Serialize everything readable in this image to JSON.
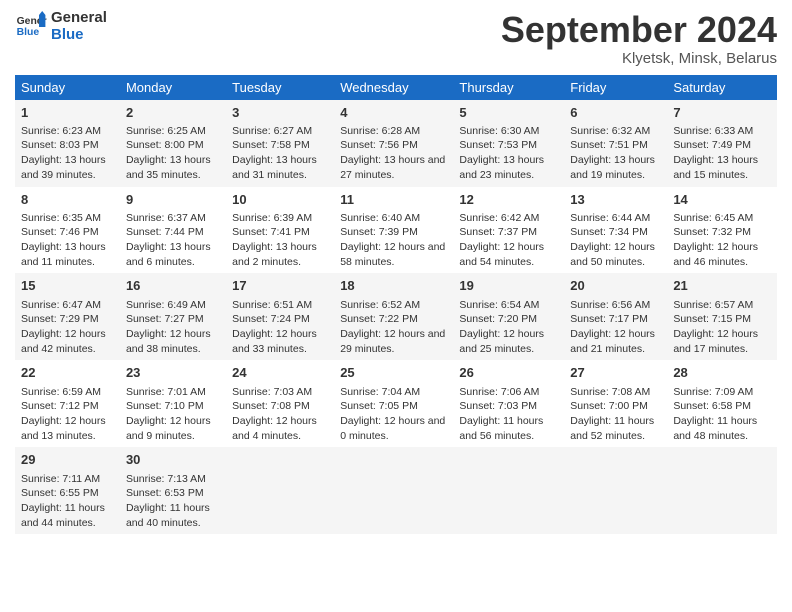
{
  "header": {
    "logo_line1": "General",
    "logo_line2": "Blue",
    "month": "September 2024",
    "location": "Klyetsk, Minsk, Belarus"
  },
  "days_of_week": [
    "Sunday",
    "Monday",
    "Tuesday",
    "Wednesday",
    "Thursday",
    "Friday",
    "Saturday"
  ],
  "weeks": [
    [
      {
        "day": "1",
        "sunrise": "6:23 AM",
        "sunset": "8:03 PM",
        "daylight": "13 hours and 39 minutes."
      },
      {
        "day": "2",
        "sunrise": "6:25 AM",
        "sunset": "8:00 PM",
        "daylight": "13 hours and 35 minutes."
      },
      {
        "day": "3",
        "sunrise": "6:27 AM",
        "sunset": "7:58 PM",
        "daylight": "13 hours and 31 minutes."
      },
      {
        "day": "4",
        "sunrise": "6:28 AM",
        "sunset": "7:56 PM",
        "daylight": "13 hours and 27 minutes."
      },
      {
        "day": "5",
        "sunrise": "6:30 AM",
        "sunset": "7:53 PM",
        "daylight": "13 hours and 23 minutes."
      },
      {
        "day": "6",
        "sunrise": "6:32 AM",
        "sunset": "7:51 PM",
        "daylight": "13 hours and 19 minutes."
      },
      {
        "day": "7",
        "sunrise": "6:33 AM",
        "sunset": "7:49 PM",
        "daylight": "13 hours and 15 minutes."
      }
    ],
    [
      {
        "day": "8",
        "sunrise": "6:35 AM",
        "sunset": "7:46 PM",
        "daylight": "13 hours and 11 minutes."
      },
      {
        "day": "9",
        "sunrise": "6:37 AM",
        "sunset": "7:44 PM",
        "daylight": "13 hours and 6 minutes."
      },
      {
        "day": "10",
        "sunrise": "6:39 AM",
        "sunset": "7:41 PM",
        "daylight": "13 hours and 2 minutes."
      },
      {
        "day": "11",
        "sunrise": "6:40 AM",
        "sunset": "7:39 PM",
        "daylight": "12 hours and 58 minutes."
      },
      {
        "day": "12",
        "sunrise": "6:42 AM",
        "sunset": "7:37 PM",
        "daylight": "12 hours and 54 minutes."
      },
      {
        "day": "13",
        "sunrise": "6:44 AM",
        "sunset": "7:34 PM",
        "daylight": "12 hours and 50 minutes."
      },
      {
        "day": "14",
        "sunrise": "6:45 AM",
        "sunset": "7:32 PM",
        "daylight": "12 hours and 46 minutes."
      }
    ],
    [
      {
        "day": "15",
        "sunrise": "6:47 AM",
        "sunset": "7:29 PM",
        "daylight": "12 hours and 42 minutes."
      },
      {
        "day": "16",
        "sunrise": "6:49 AM",
        "sunset": "7:27 PM",
        "daylight": "12 hours and 38 minutes."
      },
      {
        "day": "17",
        "sunrise": "6:51 AM",
        "sunset": "7:24 PM",
        "daylight": "12 hours and 33 minutes."
      },
      {
        "day": "18",
        "sunrise": "6:52 AM",
        "sunset": "7:22 PM",
        "daylight": "12 hours and 29 minutes."
      },
      {
        "day": "19",
        "sunrise": "6:54 AM",
        "sunset": "7:20 PM",
        "daylight": "12 hours and 25 minutes."
      },
      {
        "day": "20",
        "sunrise": "6:56 AM",
        "sunset": "7:17 PM",
        "daylight": "12 hours and 21 minutes."
      },
      {
        "day": "21",
        "sunrise": "6:57 AM",
        "sunset": "7:15 PM",
        "daylight": "12 hours and 17 minutes."
      }
    ],
    [
      {
        "day": "22",
        "sunrise": "6:59 AM",
        "sunset": "7:12 PM",
        "daylight": "12 hours and 13 minutes."
      },
      {
        "day": "23",
        "sunrise": "7:01 AM",
        "sunset": "7:10 PM",
        "daylight": "12 hours and 9 minutes."
      },
      {
        "day": "24",
        "sunrise": "7:03 AM",
        "sunset": "7:08 PM",
        "daylight": "12 hours and 4 minutes."
      },
      {
        "day": "25",
        "sunrise": "7:04 AM",
        "sunset": "7:05 PM",
        "daylight": "12 hours and 0 minutes."
      },
      {
        "day": "26",
        "sunrise": "7:06 AM",
        "sunset": "7:03 PM",
        "daylight": "11 hours and 56 minutes."
      },
      {
        "day": "27",
        "sunrise": "7:08 AM",
        "sunset": "7:00 PM",
        "daylight": "11 hours and 52 minutes."
      },
      {
        "day": "28",
        "sunrise": "7:09 AM",
        "sunset": "6:58 PM",
        "daylight": "11 hours and 48 minutes."
      }
    ],
    [
      {
        "day": "29",
        "sunrise": "7:11 AM",
        "sunset": "6:55 PM",
        "daylight": "11 hours and 44 minutes."
      },
      {
        "day": "30",
        "sunrise": "7:13 AM",
        "sunset": "6:53 PM",
        "daylight": "11 hours and 40 minutes."
      },
      {
        "day": "",
        "sunrise": "",
        "sunset": "",
        "daylight": ""
      },
      {
        "day": "",
        "sunrise": "",
        "sunset": "",
        "daylight": ""
      },
      {
        "day": "",
        "sunrise": "",
        "sunset": "",
        "daylight": ""
      },
      {
        "day": "",
        "sunrise": "",
        "sunset": "",
        "daylight": ""
      },
      {
        "day": "",
        "sunrise": "",
        "sunset": "",
        "daylight": ""
      }
    ]
  ]
}
